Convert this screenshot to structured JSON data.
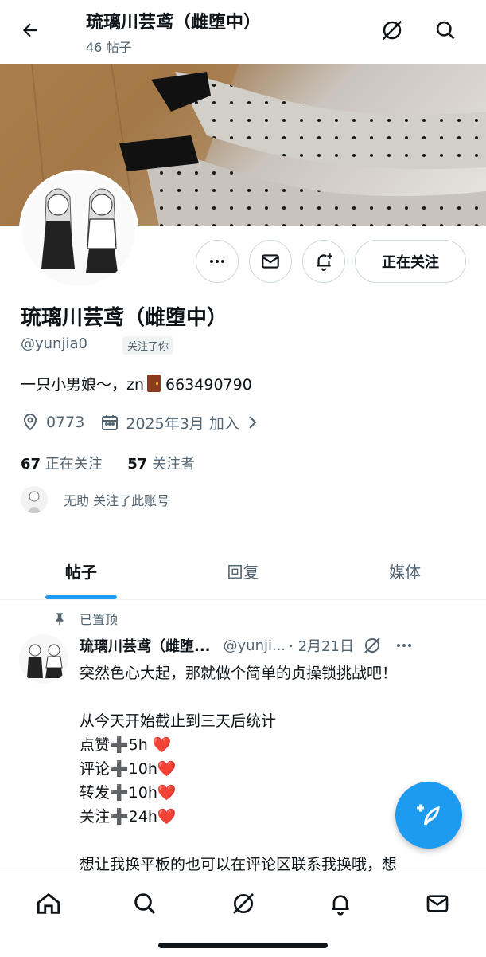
{
  "header": {
    "title": "琉璃川芸鸢（雌堕中）",
    "post_count": "46 帖子"
  },
  "profile": {
    "name": "琉璃川芸鸢（雌堕中）",
    "handle": "@yunjia0",
    "follows_you": "关注了你",
    "bio_prefix": "一只小男娘～，zn",
    "bio_suffix": "663490790",
    "location": "0773",
    "joined": "2025年3月 加入",
    "following_count": "67",
    "following_label": "正在关注",
    "followers_count": "57",
    "followers_label": "关注者",
    "followed_by": "无助 关注了此账号",
    "follow_button": "正在关注"
  },
  "tabs": [
    {
      "label": "帖子",
      "active": true
    },
    {
      "label": "回复",
      "active": false
    },
    {
      "label": "媒体",
      "active": false
    }
  ],
  "post": {
    "pinned_label": "已置顶",
    "author": "琉璃川芸鸢（雌堕...",
    "handle": "@yunji...",
    "date": "· 2月21日",
    "text": "突然色心大起，那就做个简单的贞操锁挑战吧！\n\n从今天开始截止到三天后统计\n点赞➕5h ❤️\n评论➕10h❤️\n转发➕10h❤️\n关注➕24h❤️\n\n想让我换平板的也可以在评论区联系我换哦，想"
  },
  "colors": {
    "accent": "#1d9bf0",
    "text": "#0f1419",
    "secondary": "#536471",
    "border": "#cfd9de"
  }
}
